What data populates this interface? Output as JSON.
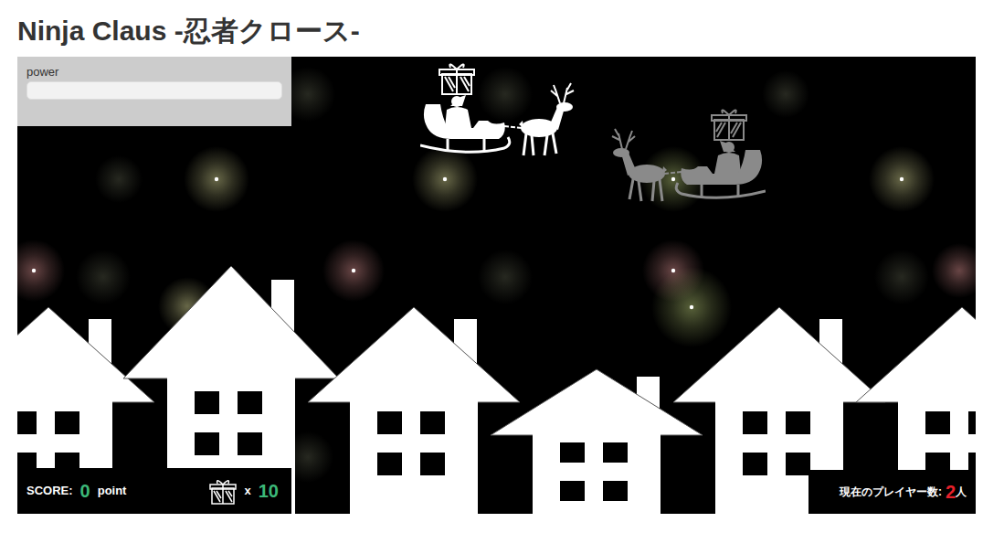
{
  "page": {
    "title": "Ninja Claus -忍者クロース-"
  },
  "power": {
    "label": "power",
    "level": 0
  },
  "sleighs": [
    {
      "color": "#ffffff",
      "facing": "right"
    },
    {
      "color": "#8a8a8a",
      "facing": "left"
    }
  ],
  "hud": {
    "score_label": "SCORE:",
    "score": "0",
    "score_unit": "point",
    "presents_prefix": "x",
    "presents": "10",
    "players_label": "現在のプレイヤー数:",
    "players_count": "2",
    "players_unit": "人"
  }
}
